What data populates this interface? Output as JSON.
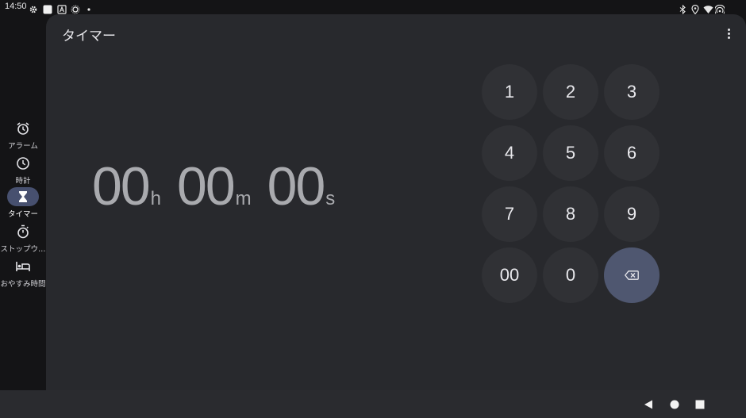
{
  "status_bar": {
    "time": "14:50"
  },
  "app": {
    "title": "タイマー"
  },
  "nav": {
    "items": [
      {
        "label": "アラーム",
        "icon": "alarm-icon",
        "active": false
      },
      {
        "label": "時計",
        "icon": "clock-icon",
        "active": false
      },
      {
        "label": "タイマー",
        "icon": "hourglass-icon",
        "active": true
      },
      {
        "label": "ストップウ…",
        "icon": "stopwatch-icon",
        "active": false
      },
      {
        "label": "おやすみ時間",
        "icon": "bed-icon",
        "active": false
      }
    ]
  },
  "timer": {
    "hours": "00",
    "hours_unit": "h",
    "minutes": "00",
    "minutes_unit": "m",
    "seconds": "00",
    "seconds_unit": "s"
  },
  "keypad": {
    "keys": [
      "1",
      "2",
      "3",
      "4",
      "5",
      "6",
      "7",
      "8",
      "9",
      "00",
      "0"
    ],
    "delete_icon": "backspace-icon"
  },
  "colors": {
    "background": "#141416",
    "card": "#28292d",
    "key": "#303135",
    "accent": "#47506f",
    "delete_key": "#4f5770",
    "timer_text": "#a9aaae"
  }
}
